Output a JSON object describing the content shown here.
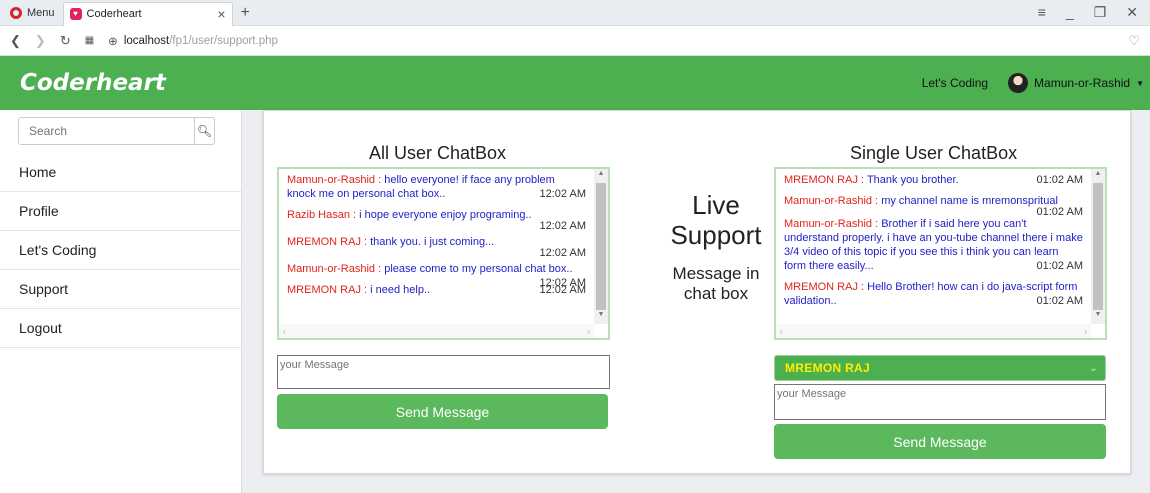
{
  "browser": {
    "menu_label": "Menu",
    "tab_title": "Coderheart",
    "tab_close": "×",
    "new_tab": "+",
    "url_host": "localhost",
    "url_path": "/fp1/user/support.php"
  },
  "navbar": {
    "brand": "Coderheart",
    "lets_coding": "Let's Coding",
    "user_name": "Mamun-or-Rashid"
  },
  "sidebar": {
    "search_placeholder": "Search",
    "items": [
      "Home",
      "Profile",
      "Let's Coding",
      "Support",
      "Logout"
    ]
  },
  "all_chat": {
    "title": "All User ChatBox",
    "messages": [
      {
        "name": "Mamun-or-Rashid",
        "text": "hello everyone! if face any problem knock me on personal chat box..",
        "time": "12:02 AM"
      },
      {
        "name": "Razib Hasan",
        "text": "i hope everyone enjoy programing..",
        "time": "12:02 AM"
      },
      {
        "name": "MREMON RAJ",
        "text": "thank you. i just coming...",
        "time": "12:02 AM"
      },
      {
        "name": "Mamun-or-Rashid",
        "text": "please come to my personal chat box..",
        "time": "12:02 AM"
      },
      {
        "name": "MREMON RAJ",
        "text": "i need help..",
        "time": "12:02 AM"
      }
    ],
    "input_placeholder": "your Message",
    "send_label": "Send Message"
  },
  "center": {
    "line1": "Live",
    "line2": "Support",
    "sub1": "Message in",
    "sub2": "chat box"
  },
  "single_chat": {
    "title": "Single User ChatBox",
    "messages": [
      {
        "name": "MREMON RAJ",
        "text": "Thank you brother.",
        "time": "01:02 AM"
      },
      {
        "name": "Mamun-or-Rashid",
        "text": "my channel name is mremonspritual",
        "time": "01:02 AM"
      },
      {
        "name": "Mamun-or-Rashid",
        "text": "Brother if i said here you can't understand properly. i have an you-tube channel there i make 3/4 video of this topic if you see this i think you can learn form there easily...",
        "time": "01:02 AM"
      },
      {
        "name": "MREMON RAJ",
        "text": "Hello Brother! how can i do java-script form validation..",
        "time": "01:02 AM"
      }
    ],
    "selected_user": "MREMON RAJ",
    "input_placeholder": "your Message",
    "send_label": "Send Message"
  }
}
